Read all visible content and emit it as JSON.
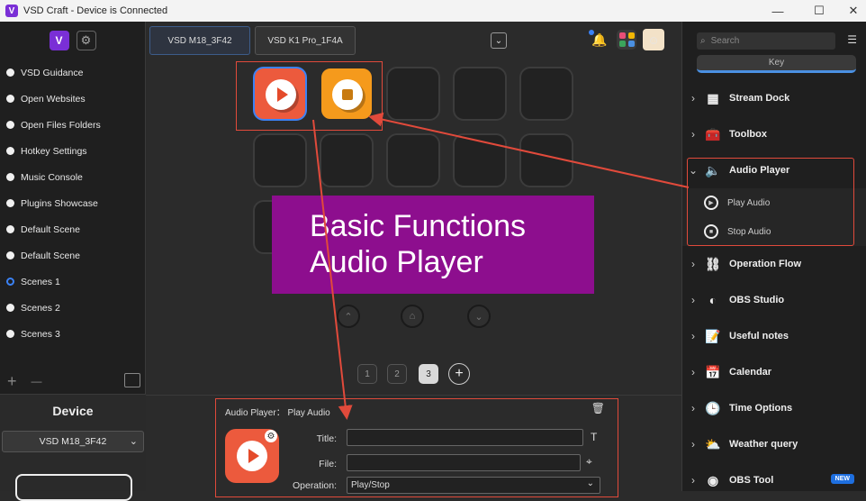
{
  "window": {
    "title": "VSD Craft - Device is Connected",
    "logo": "V",
    "minimize": "—",
    "maximize": "☐",
    "close": "✕"
  },
  "sidebar": {
    "logo": "V",
    "scenes": [
      {
        "label": "VSD Guidance",
        "active": false
      },
      {
        "label": "Open Websites",
        "active": false
      },
      {
        "label": "Open Files Folders",
        "active": false
      },
      {
        "label": "Hotkey Settings",
        "active": false
      },
      {
        "label": "Music Console",
        "active": false
      },
      {
        "label": "Plugins Showcase",
        "active": false
      },
      {
        "label": "Default Scene",
        "active": false
      },
      {
        "label": "Default Scene",
        "active": false
      },
      {
        "label": "Scenes 1",
        "active": true
      },
      {
        "label": "Scenes 2",
        "active": false
      },
      {
        "label": "Scenes 3",
        "active": false
      }
    ],
    "add": "+",
    "remove": "—"
  },
  "device": {
    "title": "Device",
    "selected": "VSD M18_3F42"
  },
  "tabs": [
    "VSD M18_3F42",
    "VSD K1 Pro_1F4A"
  ],
  "pager": {
    "pages": [
      "1",
      "2",
      "3"
    ],
    "current": "3",
    "add": "+"
  },
  "banner": {
    "line1": "Basic Functions",
    "line2": "Audio Player"
  },
  "properties": {
    "header": "Audio Player： Play Audio",
    "title_label": "Title:",
    "title_value": "",
    "file_label": "File:",
    "file_value": "",
    "operation_label": "Operation:",
    "operation_value": "Play/Stop"
  },
  "right": {
    "search_placeholder": "Search",
    "key_tab": "Key",
    "categories": [
      {
        "label": "Stream Dock",
        "icon": "grid-icon"
      },
      {
        "label": "Toolbox",
        "icon": "toolbox-icon"
      },
      {
        "label": "Audio Player",
        "icon": "speaker-icon",
        "expanded": true,
        "actions": [
          "Play Audio",
          "Stop Audio"
        ]
      },
      {
        "label": "Operation Flow",
        "icon": "flow-icon"
      },
      {
        "label": "OBS Studio",
        "icon": "obs-icon"
      },
      {
        "label": "Useful notes",
        "icon": "note-icon"
      },
      {
        "label": "Calendar",
        "icon": "calendar-icon"
      },
      {
        "label": "Time Options",
        "icon": "clock-icon"
      },
      {
        "label": "Weather query",
        "icon": "weather-icon"
      },
      {
        "label": "OBS Tool",
        "icon": "obs-tool-icon",
        "badge": "NEW"
      }
    ]
  },
  "colors": {
    "accent": "#3b82f6",
    "annotation": "#e14a3b",
    "banner": "#8d0e8e",
    "play_key": "#ec5a3d",
    "stop_key": "#f59a1c"
  }
}
